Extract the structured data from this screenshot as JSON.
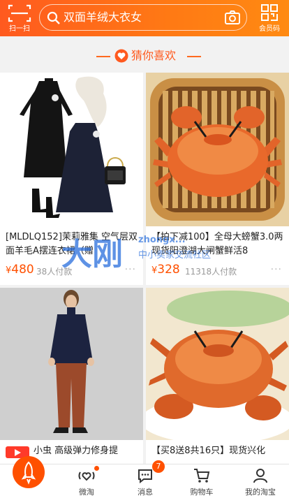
{
  "header": {
    "scan_label": "扫一扫",
    "search_text": "双面羊绒大衣女",
    "vip_label": "会员码"
  },
  "section": {
    "title": "猜你喜欢"
  },
  "products": [
    {
      "title": "[MLDLQ152]茉莉雅集 空气层双面羊毛A摆连衣裙（赠",
      "currency": "¥",
      "price": "480",
      "sold": "38人付款",
      "more": "···"
    },
    {
      "title": "【拍下减100】全母大螃蟹3.0两现货阳澄湖大闸蟹鲜活8",
      "currency": "¥",
      "price": "328",
      "sold": "11318人付款",
      "more": "···"
    },
    {
      "title": "小虫 高级弹力修身提",
      "has_video": true
    },
    {
      "title": "【买8送8共16只】现货兴化"
    }
  ],
  "watermark": {
    "big": "大刚",
    "url": "zhongx...",
    "cn": "中小卖家交流社区"
  },
  "tabbar": {
    "weitao": "微淘",
    "message": "消息",
    "message_badge": "7",
    "cart": "购物车",
    "me": "我的淘宝"
  },
  "colors": {
    "accent": "#ff5000",
    "header_start": "#ff5a1f",
    "header_end": "#ff8a12"
  }
}
